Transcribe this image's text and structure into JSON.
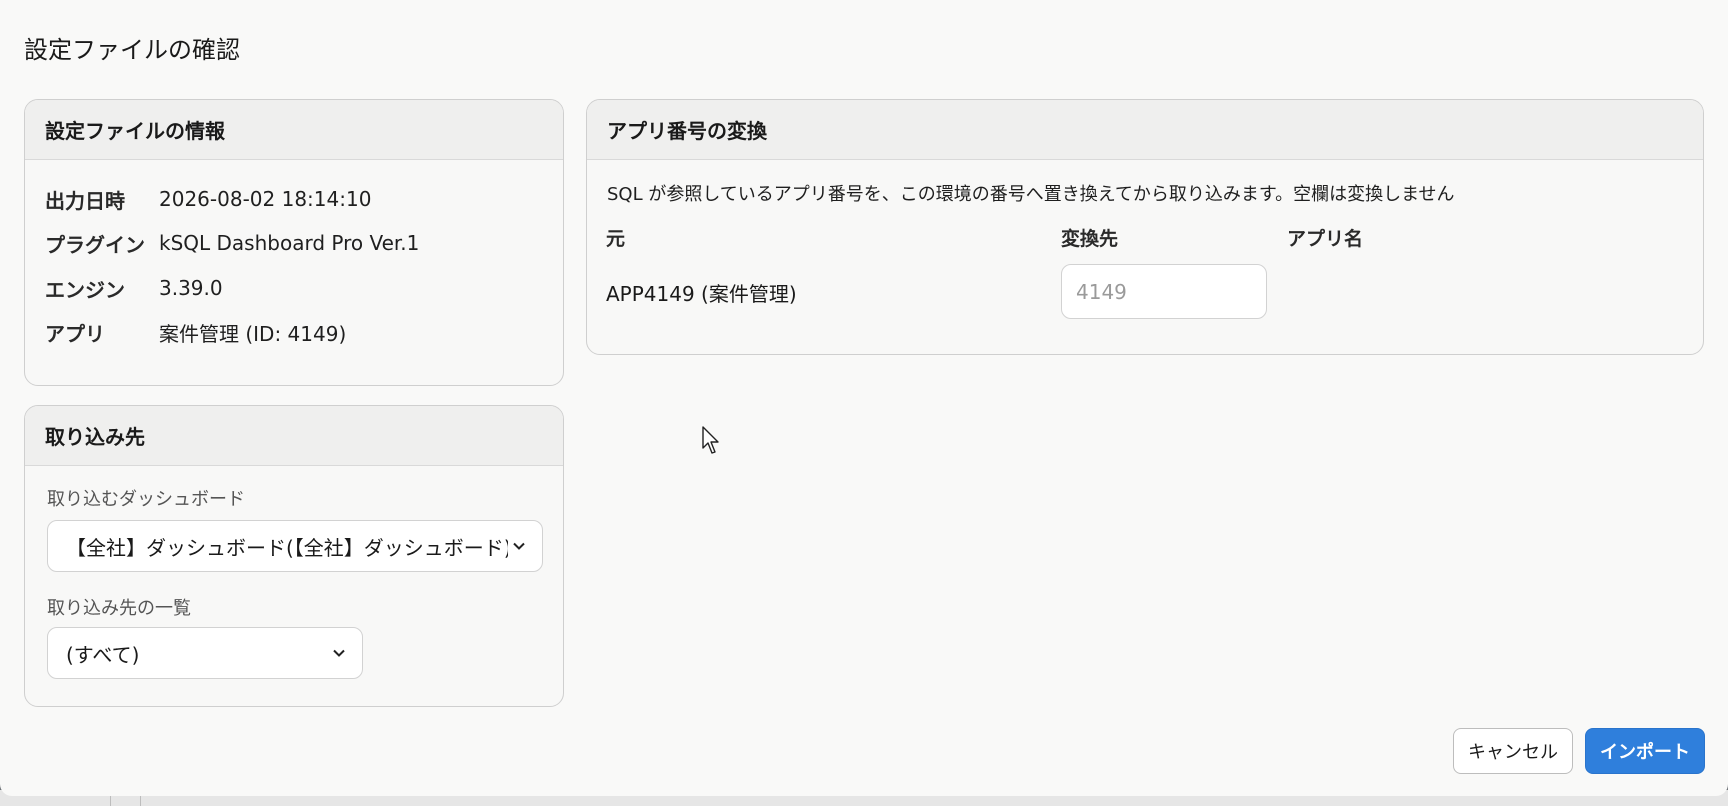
{
  "dialog": {
    "title": "設定ファイルの確認"
  },
  "info": {
    "title": "設定ファイルの情報",
    "rows": [
      {
        "label": "出力日時",
        "value": "2026-08-02 18:14:10"
      },
      {
        "label": "プラグイン",
        "value": "kSQL Dashboard Pro Ver.1"
      },
      {
        "label": "エンジン",
        "value": "3.39.0"
      },
      {
        "label": "アプリ",
        "value": "案件管理 (ID: 4149)"
      }
    ]
  },
  "import_target": {
    "title": "取り込み先",
    "dashboard_label": "取り込むダッシュボード",
    "dashboard_value": "【全社】ダッシュボード(【全社】ダッシュボード) — タブ",
    "destination_label": "取り込み先の一覧",
    "destination_value": "(すべて)"
  },
  "conversion": {
    "title": "アプリ番号の変換",
    "description": "SQL が参照しているアプリ番号を、この環境の番号へ置き換えてから取り込みます。空欄は変換しません",
    "col_source": "元",
    "col_target": "変換先",
    "col_appname": "アプリ名",
    "row": {
      "source": "APP4149 (案件管理)",
      "target_placeholder": "4149",
      "appname": ""
    }
  },
  "buttons": {
    "cancel": "キャンセル",
    "import": "インポート"
  },
  "colors": {
    "primary": "#2f7fdc"
  },
  "icons": {
    "select_arrow": "chevron-down-icon",
    "pointer": "mouse-cursor-icon"
  }
}
